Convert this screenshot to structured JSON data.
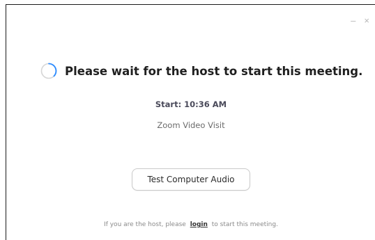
{
  "window": {
    "controls": {
      "minimize_icon": "minimize-icon",
      "close_icon": "close-icon",
      "minimize_glyph": "–",
      "close_glyph": "×"
    }
  },
  "waiting": {
    "spinner_icon": "loading-spinner-icon",
    "message": "Please wait for the host to start this meeting.",
    "start_time": "Start: 10:36 AM",
    "meeting_name": "Zoom Video Visit"
  },
  "actions": {
    "test_audio_label": "Test Computer Audio"
  },
  "footer": {
    "prefix": "If you are the host, please",
    "link_label": "login",
    "suffix": "to start this meeting."
  },
  "colors": {
    "spinner_accent": "#2d8cff",
    "spinner_track": "#d6d6d6",
    "headline": "#1f1f1f"
  }
}
